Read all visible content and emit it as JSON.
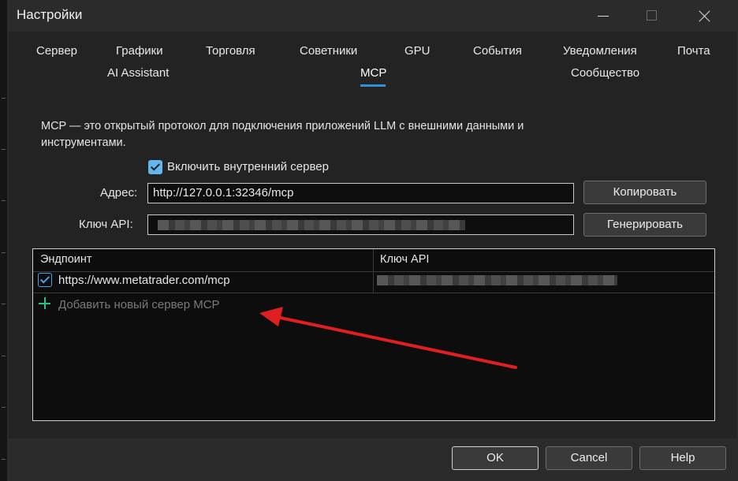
{
  "window": {
    "title": "Настройки"
  },
  "tabs": [
    {
      "label": "Сервер"
    },
    {
      "label": "Графики"
    },
    {
      "label": "Торговля"
    },
    {
      "label": "Советники"
    },
    {
      "label": "GPU"
    },
    {
      "label": "События"
    },
    {
      "label": "Уведомления"
    },
    {
      "label": "Почта"
    },
    {
      "label": "AI Assistant"
    },
    {
      "label": "MCP"
    },
    {
      "label": "Сообщество"
    }
  ],
  "active_tab": "MCP",
  "mcp": {
    "description": "MCP — это открытый протокол для подключения приложений LLM с внешними данными и инструментами.",
    "enable_server_label": "Включить внутренний сервер",
    "enable_server_checked": true,
    "address_label": "Адрес:",
    "address_value": "http://127.0.0.1:32346/mcp",
    "copy_button": "Копировать",
    "api_key_label": "Ключ API:",
    "generate_button": "Генерировать"
  },
  "table": {
    "columns": [
      "Эндпоинт",
      "Ключ API"
    ],
    "rows": [
      {
        "checked": true,
        "endpoint": "https://www.metatrader.com/mcp"
      }
    ],
    "add_row_label": "Добавить новый сервер MCP"
  },
  "footer": {
    "ok": "OK",
    "cancel": "Cancel",
    "help": "Help"
  },
  "colors": {
    "accent": "#2f8fd8",
    "add_icon": "#2ec27e",
    "arrow": "#e02020"
  }
}
